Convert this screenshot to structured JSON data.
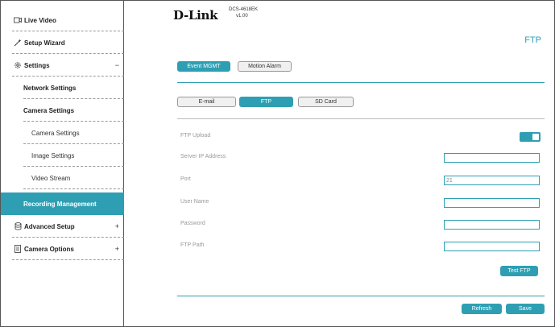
{
  "sidebar": {
    "items": [
      {
        "label": "Live Video",
        "icon": "video-icon"
      },
      {
        "label": "Setup Wizard",
        "icon": "wand-icon"
      },
      {
        "label": "Settings",
        "icon": "gear-icon",
        "toggle": "−"
      },
      {
        "label": "Network Settings"
      },
      {
        "label": "Camera Settings"
      },
      {
        "label": "Camera Settings"
      },
      {
        "label": "Image Settings"
      },
      {
        "label": "Video Stream"
      },
      {
        "label": "Recording Management"
      },
      {
        "label": "Advanced Setup",
        "icon": "database-icon",
        "toggle": "+"
      },
      {
        "label": "Camera Options",
        "icon": "document-icon",
        "toggle": "+"
      }
    ]
  },
  "header": {
    "logo": "D-Link",
    "model": "DCS-4618EK",
    "version": "v1.00",
    "page_title": "FTP"
  },
  "tabs_primary": [
    "Event MGMT",
    "Motion Alarm"
  ],
  "tabs_secondary": [
    "E-mail",
    "FTP",
    "SD Card"
  ],
  "form": {
    "ftp_upload": "FTP Upload",
    "server_ip": "Server IP Address",
    "port": "Port",
    "port_value": "21",
    "user_name": "User Name",
    "password": "Password",
    "ftp_path": "FTP Path",
    "test_button": "Test FTP"
  },
  "footer": {
    "refresh": "Refresh",
    "save": "Save"
  },
  "colors": {
    "accent": "#2e9fb3"
  }
}
